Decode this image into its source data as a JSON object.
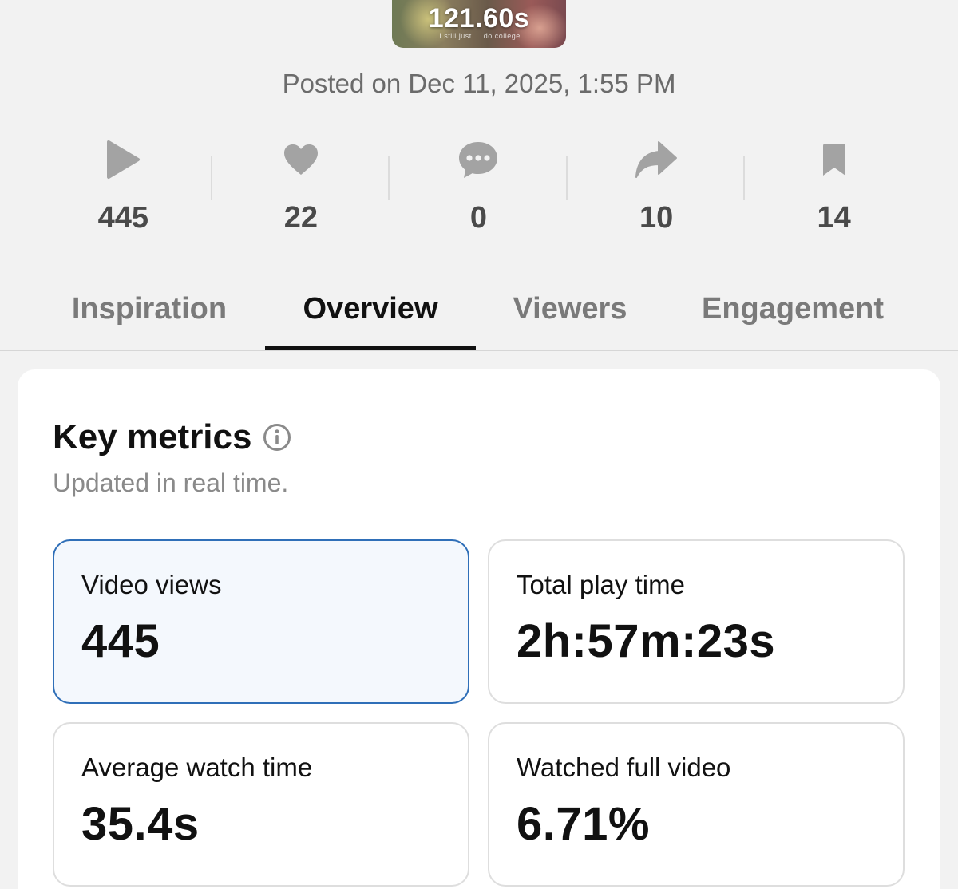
{
  "video": {
    "duration": "121.60s",
    "caption_fragment": "I still just    ... do college"
  },
  "posted": "Posted on Dec 11, 2025, 1:55 PM",
  "stats": [
    {
      "icon": "play-icon",
      "value": "445"
    },
    {
      "icon": "heart-icon",
      "value": "22"
    },
    {
      "icon": "comment-icon",
      "value": "0"
    },
    {
      "icon": "share-icon",
      "value": "10"
    },
    {
      "icon": "bookmark-icon",
      "value": "14"
    }
  ],
  "tabs": [
    {
      "label": "Inspiration",
      "active": false
    },
    {
      "label": "Overview",
      "active": true
    },
    {
      "label": "Viewers",
      "active": false
    },
    {
      "label": "Engagement",
      "active": false
    }
  ],
  "key_metrics": {
    "title": "Key metrics",
    "subtitle": "Updated in real time.",
    "items": [
      {
        "label": "Video views",
        "value": "445",
        "selected": true
      },
      {
        "label": "Total play time",
        "value": "2h:57m:23s",
        "selected": false
      },
      {
        "label": "Average watch time",
        "value": "35.4s",
        "selected": false
      },
      {
        "label": "Watched full video",
        "value": "6.71%",
        "selected": false
      }
    ]
  },
  "colors": {
    "background": "#f2f2f2",
    "icon_gray": "#a3a3a3",
    "selected_border": "#2f6fb8",
    "selected_fill": "#f4f8fd"
  }
}
